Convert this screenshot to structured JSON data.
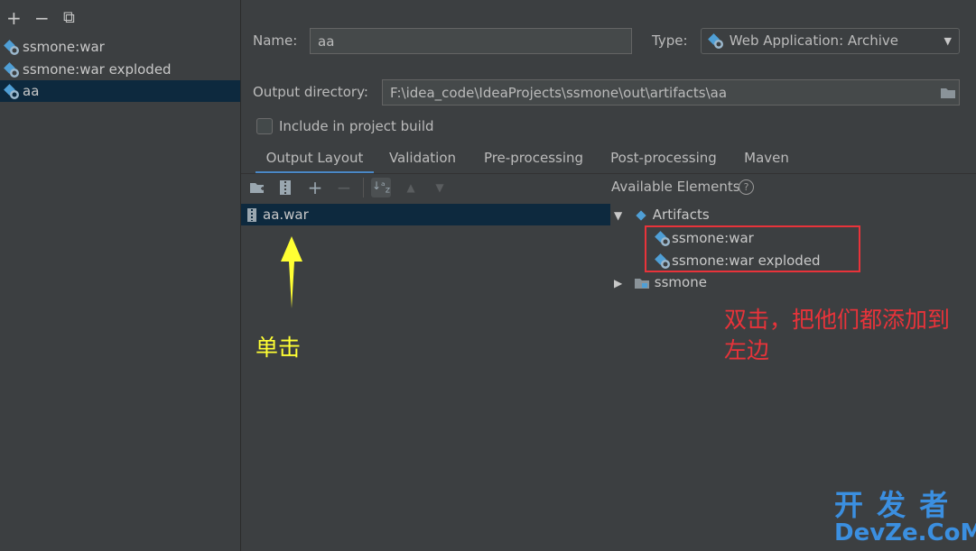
{
  "left_toolbar": {
    "add": "+",
    "remove": "−",
    "copy": "⧉"
  },
  "artifacts": [
    {
      "label": "ssmone:war",
      "selected": false
    },
    {
      "label": "ssmone:war exploded",
      "selected": false
    },
    {
      "label": "aa",
      "selected": true
    }
  ],
  "form": {
    "name_label": "Name:",
    "name_value": "aa",
    "type_label": "Type:",
    "type_value": "Web Application: Archive",
    "output_label": "Output directory:",
    "output_value": "F:\\idea_code\\IdeaProjects\\ssmone\\out\\artifacts\\aa",
    "include_label": "Include in project build",
    "include_checked": false
  },
  "tabs": [
    {
      "label": "Output Layout",
      "active": true
    },
    {
      "label": "Validation",
      "active": false
    },
    {
      "label": "Pre-processing",
      "active": false
    },
    {
      "label": "Post-processing",
      "active": false
    },
    {
      "label": "Maven",
      "active": false
    }
  ],
  "output_tree": {
    "root_label": "aa.war"
  },
  "available": {
    "header": "Available Elements",
    "help": "?",
    "artifacts_group": "Artifacts",
    "artifact_items": [
      "ssmone:war",
      "ssmone:war exploded"
    ],
    "module": "ssmone"
  },
  "annotations": {
    "click_note": "单击",
    "double_click_note_line1": "双击，把他们都添加到",
    "double_click_note_line2": "左边"
  },
  "watermark": {
    "top": "开 发 者",
    "bottom": "DevZe.CoM"
  },
  "colors": {
    "background": "#3c3f41",
    "selection": "#0d293e",
    "accent_tab": "#4a88c7",
    "annotation_red": "#e8333a",
    "annotation_yellow": "#ffff33"
  }
}
